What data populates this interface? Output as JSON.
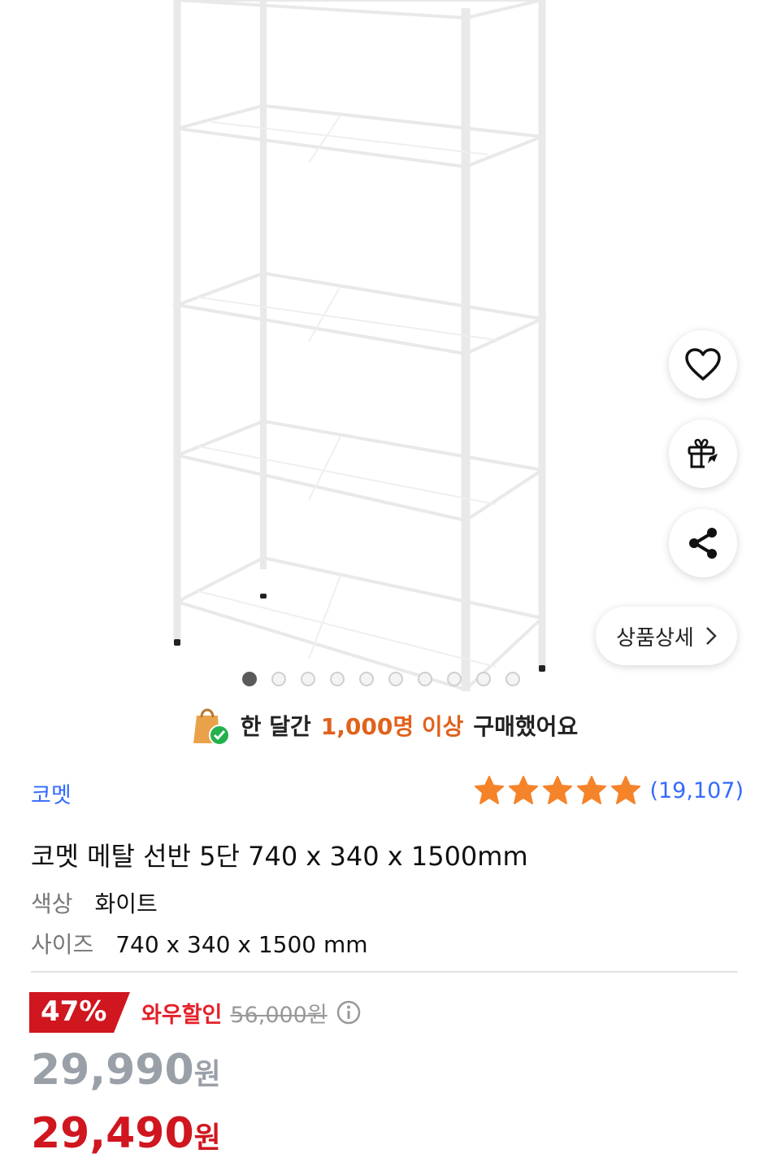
{
  "gallery": {
    "dot_count": 10,
    "active_index": 0
  },
  "actions": {
    "detail_label": "상품상세"
  },
  "social_proof": {
    "prefix": "한 달간",
    "highlight": "1,000명 이상",
    "suffix": "구매했어요"
  },
  "product": {
    "brand": "코멧",
    "rating": 5,
    "review_count": "(19,107)",
    "title": "코멧 메탈 선반 5단 740 x 340 x 1500mm",
    "options": [
      {
        "key": "색상",
        "value": "화이트"
      },
      {
        "key": "사이즈",
        "value": "740 x 340 x 1500 mm"
      }
    ]
  },
  "pricing": {
    "discount_rate": "47%",
    "discount_label": "와우할인",
    "original_price": "56,000원",
    "price": "29,990",
    "sale_price": "29,490",
    "currency": "원"
  },
  "colors": {
    "brand_blue": "#346aff",
    "star_orange": "#f5832a",
    "sale_red": "#d0161f",
    "highlight_orange": "#e0621c"
  }
}
